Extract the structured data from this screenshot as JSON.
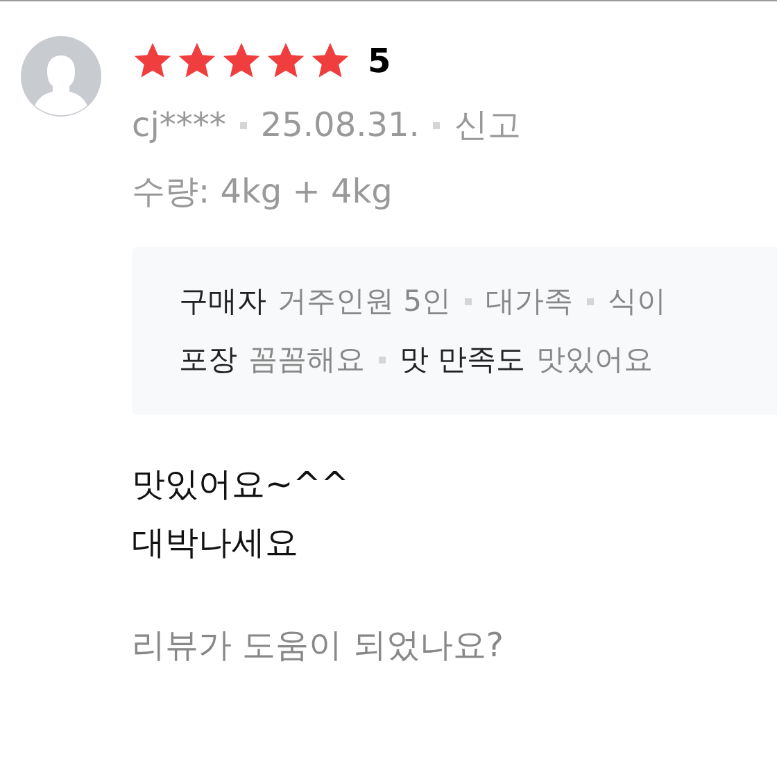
{
  "review": {
    "stars": 5,
    "score": "5",
    "user": "cj****",
    "date": "25.08.31.",
    "report": "신고",
    "option": "수량: 4kg + 4kg",
    "survey": [
      {
        "items": [
          {
            "label": "구매자",
            "values": [
              "거주인원 5인",
              "대가족",
              "식이"
            ]
          }
        ]
      },
      {
        "items": [
          {
            "label": "포장",
            "values": [
              "꼼꼼해요"
            ]
          },
          {
            "label": "맛 만족도",
            "values": [
              "맛있어요"
            ]
          }
        ]
      }
    ],
    "body": [
      "맛있어요~^^",
      "대박나세요"
    ],
    "helpful_question": "리뷰가 도움이 되었나요?"
  }
}
